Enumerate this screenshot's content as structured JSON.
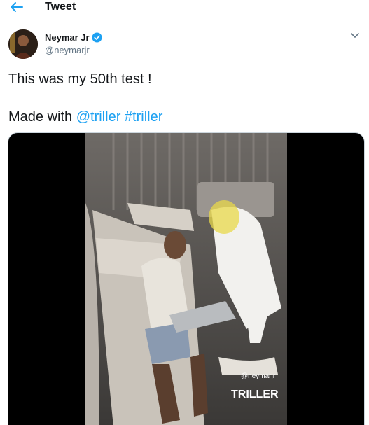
{
  "header": {
    "title": "Tweet"
  },
  "author": {
    "display_name": "Neymar Jr",
    "handle": "@neymarjr",
    "verified": true
  },
  "tweet": {
    "text_line1": "This was my 50th test !",
    "text_line2_prefix": "Made with ",
    "mention": "@triller",
    "hashtag": "#triller"
  },
  "video": {
    "watermark_handle": "@neymarjr",
    "watermark_brand": "TRILLER"
  },
  "colors": {
    "accent": "#1da1f2",
    "text": "#14171a",
    "secondary": "#657786"
  },
  "icons": {
    "back": "arrow-left-icon",
    "verified": "verified-badge-icon",
    "more": "chevron-down-icon"
  }
}
